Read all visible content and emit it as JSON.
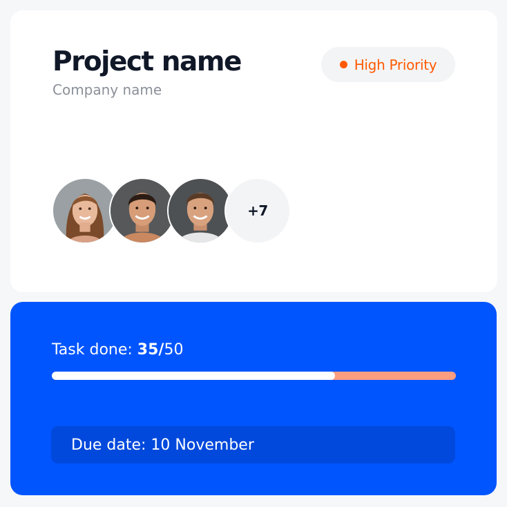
{
  "project": {
    "title": "Project name",
    "company": "Company name",
    "priority_label": "High Priority",
    "priority_color": "#ff5a00"
  },
  "team": {
    "members": [
      {
        "name": "team-member-1",
        "icon": "avatar-woman"
      },
      {
        "name": "team-member-2",
        "icon": "avatar-man"
      },
      {
        "name": "team-member-3",
        "icon": "avatar-man"
      }
    ],
    "more_label": "+7"
  },
  "tasks": {
    "prefix": "Task done: ",
    "done": "35/",
    "total": "50",
    "progress_fraction": 0.7
  },
  "due": {
    "label": "Due date: 10 November"
  },
  "colors": {
    "accent": "#0055ff",
    "progress_track": "#ff9d80"
  }
}
